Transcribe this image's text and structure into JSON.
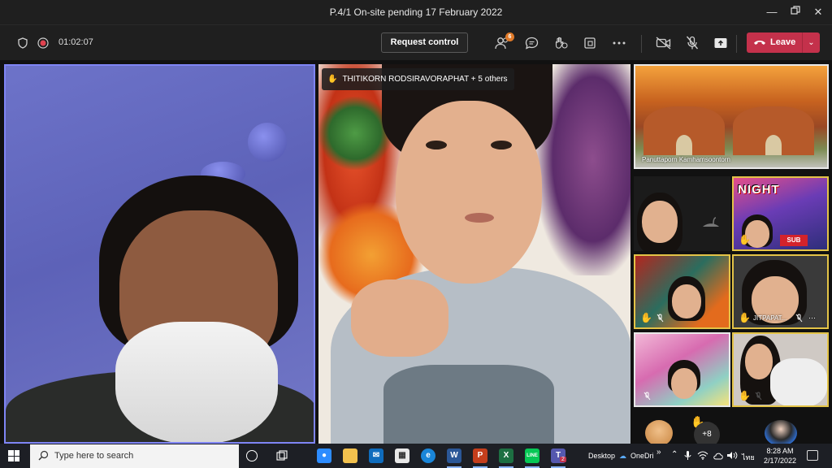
{
  "window": {
    "title": "P.4/1 On-site pending 17 February 2022"
  },
  "toolbar": {
    "timer": "01:02:07",
    "request_control": "Request control",
    "participants_badge": "6",
    "leave_label": "Leave"
  },
  "tiles": {
    "main_name_chip": "THITIKORN RODSIRAVORAPHAT + 5 others",
    "landscape_name": "Panuttaporn Kamhamsoontorn",
    "game_title": "NIGHT",
    "game_badge": "SUB",
    "small_name": "JITPAPAT..."
  },
  "strip": {
    "overflow_count": "+8"
  },
  "taskbar": {
    "search_placeholder": "Type here to search",
    "desktop_label": "Desktop",
    "onedrive_label": "OneDri",
    "lang": "ไทย",
    "time": "8:28 AM",
    "date": "2/17/2022",
    "teams_badge": "2"
  },
  "colors": {
    "leave_red": "#c4314b",
    "active_speaker_border": "#7f85f5",
    "raised_hand_border": "#e3c347",
    "notification_badge": "#e07a29"
  },
  "icons": [
    "shield-icon",
    "record-icon",
    "participants-icon",
    "chat-icon",
    "reactions-icon",
    "share-tray-icon",
    "more-icon",
    "camera-off-icon",
    "mic-off-icon",
    "share-icon",
    "phone-icon",
    "raised-hand-icon",
    "windows-start-icon",
    "search-icon",
    "cortana-icon",
    "task-view-icon",
    "zoom-icon",
    "file-explorer-icon",
    "mail-icon",
    "store-icon",
    "edge-icon",
    "word-icon",
    "powerpoint-icon",
    "excel-icon",
    "line-icon",
    "teams-icon"
  ]
}
